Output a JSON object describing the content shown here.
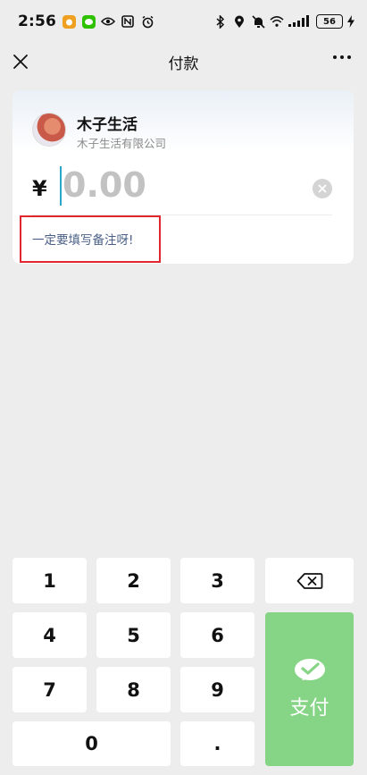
{
  "status_bar": {
    "time": "2:56",
    "battery": "56"
  },
  "nav": {
    "title": "付款"
  },
  "merchant": {
    "name": "木子生活",
    "company": "木子生活有限公司"
  },
  "amount": {
    "currency": "¥",
    "value": "0.00"
  },
  "note": {
    "text": "一定要填写备注呀!"
  },
  "keypad": {
    "keys": [
      "1",
      "2",
      "3",
      "4",
      "5",
      "6",
      "7",
      "8",
      "9",
      "0",
      "."
    ],
    "pay_label": "支付"
  },
  "colors": {
    "pay_green": "#86d586",
    "highlight_red": "#e0262e",
    "note_text": "#4a5f86",
    "cursor": "#2aa6c9"
  }
}
